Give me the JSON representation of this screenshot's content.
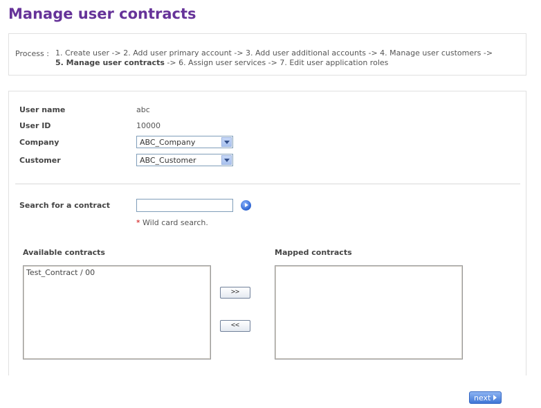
{
  "page": {
    "title": "Manage user contracts"
  },
  "process": {
    "label": "Process :",
    "line1": "1. Create user -> 2. Add user primary account -> 3. Add user additional accounts -> 4. Manage user customers ->",
    "current": "5. Manage user contracts",
    "line2_rest": " -> 6. Assign user services -> 7. Edit user application roles"
  },
  "form": {
    "username_label": "User name",
    "username_value": "abc",
    "userid_label": "User ID",
    "userid_value": "10000",
    "company_label": "Company",
    "company_value": "ABC_Company",
    "customer_label": "Customer",
    "customer_value": "ABC_Customer"
  },
  "search": {
    "label": "Search for a contract",
    "value": "",
    "required_marker": "*",
    "hint": "Wild card search."
  },
  "contracts": {
    "available_label": "Available contracts",
    "available_items": [
      "Test_Contract / 00"
    ],
    "mapped_label": "Mapped contracts",
    "mapped_items": [],
    "add_label": ">>",
    "remove_label": "<<"
  },
  "footer": {
    "next_label": "next"
  },
  "colors": {
    "title": "#663399",
    "button": "#3f76d6"
  },
  "icons": {
    "go": "go-arrow-icon",
    "next": "next-arrow-icon",
    "dropdown": "chevron-down-icon"
  }
}
